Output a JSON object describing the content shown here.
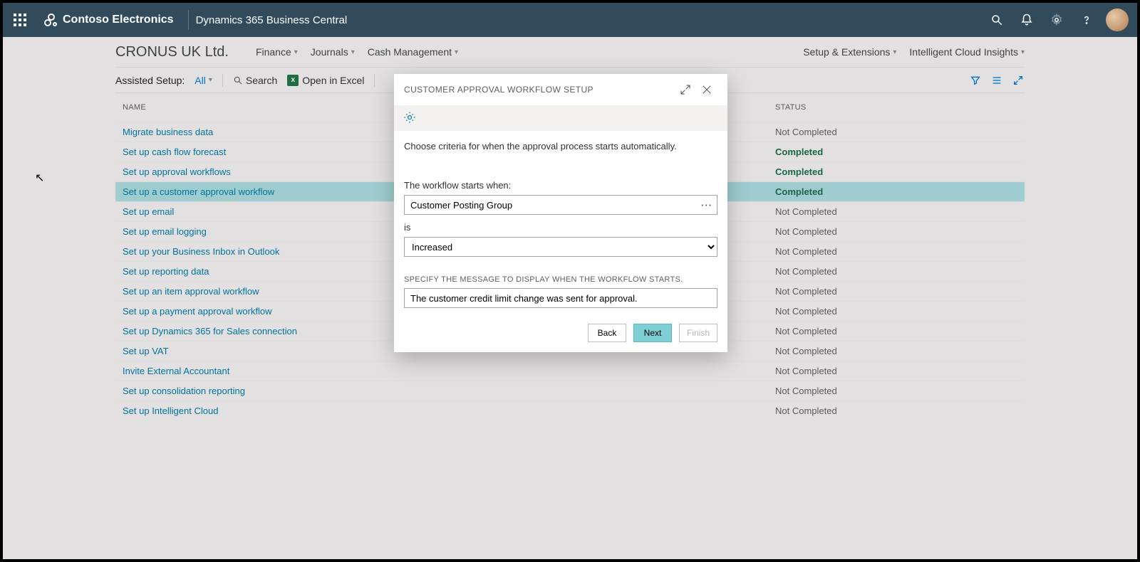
{
  "suite": {
    "brand": "Contoso Electronics",
    "app": "Dynamics 365 Business Central"
  },
  "nav": {
    "company": "CRONUS UK Ltd.",
    "items": [
      "Finance",
      "Journals",
      "Cash Management",
      "Setup & Extensions",
      "Intelligent Cloud Insights"
    ]
  },
  "toolbar": {
    "label": "Assisted Setup:",
    "filter": "All",
    "search": "Search",
    "excel": "Open in Excel"
  },
  "columns": {
    "name": "NAME",
    "status": "STATUS"
  },
  "rows": [
    {
      "name": "Migrate business data",
      "status": "Not Completed",
      "completed": false,
      "selected": false
    },
    {
      "name": "Set up cash flow forecast",
      "status": "Completed",
      "completed": true,
      "selected": false
    },
    {
      "name": "Set up approval workflows",
      "status": "Completed",
      "completed": true,
      "selected": false
    },
    {
      "name": "Set up a customer approval workflow",
      "status": "Completed",
      "completed": true,
      "selected": true
    },
    {
      "name": "Set up email",
      "status": "Not Completed",
      "completed": false,
      "selected": false
    },
    {
      "name": "Set up email logging",
      "status": "Not Completed",
      "completed": false,
      "selected": false
    },
    {
      "name": "Set up your Business Inbox in Outlook",
      "status": "Not Completed",
      "completed": false,
      "selected": false
    },
    {
      "name": "Set up reporting data",
      "status": "Not Completed",
      "completed": false,
      "selected": false
    },
    {
      "name": "Set up an item approval workflow",
      "status": "Not Completed",
      "completed": false,
      "selected": false
    },
    {
      "name": "Set up a payment approval workflow",
      "status": "Not Completed",
      "completed": false,
      "selected": false
    },
    {
      "name": "Set up Dynamics 365 for Sales connection",
      "status": "Not Completed",
      "completed": false,
      "selected": false
    },
    {
      "name": "Set up VAT",
      "status": "Not Completed",
      "completed": false,
      "selected": false
    },
    {
      "name": "Invite External Accountant",
      "status": "Not Completed",
      "completed": false,
      "selected": false
    },
    {
      "name": "Set up consolidation reporting",
      "status": "Not Completed",
      "completed": false,
      "selected": false
    },
    {
      "name": "Set up Intelligent Cloud",
      "status": "Not Completed",
      "completed": false,
      "selected": false
    }
  ],
  "modal": {
    "title": "CUSTOMER APPROVAL WORKFLOW SETUP",
    "intro": "Choose criteria for when the approval process starts automatically.",
    "starts_label": "The workflow starts when:",
    "field_value": "Customer Posting Group",
    "is_label": "is",
    "condition_value": "Increased",
    "message_caption": "SPECIFY THE MESSAGE TO DISPLAY WHEN THE WORKFLOW STARTS.",
    "message_value": "The customer credit limit change was sent for approval.",
    "buttons": {
      "back": "Back",
      "next": "Next",
      "finish": "Finish"
    }
  }
}
